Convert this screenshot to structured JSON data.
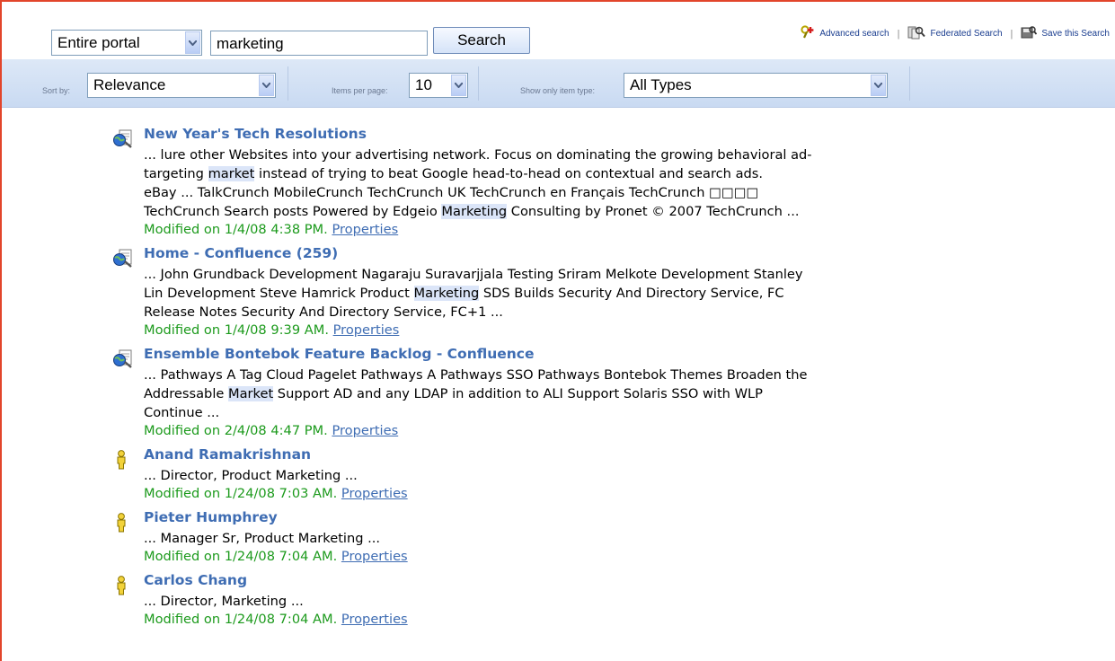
{
  "search": {
    "scope": "Entire portal",
    "query": "marketing",
    "button": "Search"
  },
  "links": {
    "advanced": "Advanced search",
    "federated": "Federated Search",
    "save": "Save this Search"
  },
  "filters": {
    "sort_label": "Sort by:",
    "sort_value": "Relevance",
    "per_page_label": "Items per page:",
    "per_page_value": "10",
    "type_label": "Show only item type:",
    "type_value": "All Types"
  },
  "results": [
    {
      "title": "New Year's Tech Resolutions",
      "icon": "web-document-icon",
      "lines": [
        [
          "... lure other Websites into your advertising network. Focus on dominating the growing behavioral ad-"
        ],
        [
          "targeting ",
          {
            "hl": "market"
          },
          " instead of trying to beat Google head-to-head on contextual and search ads."
        ],
        [
          "eBay ... TalkCrunch MobileCrunch TechCrunch UK TechCrunch en Français TechCrunch □□□□"
        ],
        [
          "TechCrunch Search posts Powered by Edgeio ",
          {
            "hl": "Marketing"
          },
          " Consulting by Pronet © 2007 TechCrunch ..."
        ]
      ],
      "modified": "Modified on 1/4/08 4:38 PM.",
      "properties": "Properties"
    },
    {
      "title": "Home - Confluence (259)",
      "icon": "web-document-icon",
      "lines": [
        [
          "... John Grundback Development Nagaraju Suravarjjala Testing Sriram Melkote Development Stanley"
        ],
        [
          "Lin Development Steve Hamrick Product ",
          {
            "hl": "Marketing"
          },
          " SDS Builds Security And Directory Service, FC"
        ],
        [
          "Release Notes Security And Directory Service, FC+1 ..."
        ]
      ],
      "modified": "Modified on 1/4/08 9:39 AM.",
      "properties": "Properties"
    },
    {
      "title": "Ensemble Bontebok Feature Backlog - Confluence",
      "icon": "web-document-icon",
      "lines": [
        [
          "... Pathways A Tag Cloud Pagelet Pathways A Pathways SSO Pathways Bontebok Themes Broaden the"
        ],
        [
          "Addressable ",
          {
            "hl": "Market"
          },
          " Support AD and any LDAP in addition to ALI Support Solaris SSO with WLP"
        ],
        [
          "Continue ..."
        ]
      ],
      "modified": "Modified on 2/4/08 4:47 PM.",
      "properties": "Properties"
    },
    {
      "title": "Anand Ramakrishnan",
      "icon": "user-icon",
      "lines": [
        [
          "... Director, Product Marketing ..."
        ]
      ],
      "modified": "Modified on 1/24/08 7:03 AM.",
      "properties": "Properties"
    },
    {
      "title": "Pieter Humphrey",
      "icon": "user-icon",
      "lines": [
        [
          "... Manager Sr, Product Marketing ..."
        ]
      ],
      "modified": "Modified on 1/24/08 7:04 AM.",
      "properties": "Properties"
    },
    {
      "title": "Carlos Chang",
      "icon": "user-icon",
      "lines": [
        [
          "... Director, Marketing ..."
        ]
      ],
      "modified": "Modified on 1/24/08 7:04 AM.",
      "properties": "Properties"
    }
  ],
  "colors": {
    "frame_border": "#e2452b",
    "title_link": "#3f6db3",
    "meta_green": "#1c9a1c",
    "highlight": "#dbe5f8"
  }
}
